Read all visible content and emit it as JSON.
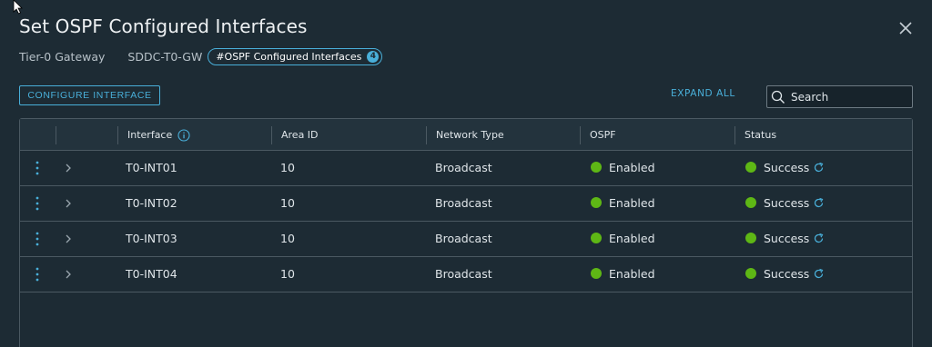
{
  "modal": {
    "title": "Set OSPF Configured Interfaces",
    "gateway_type": "Tier-0 Gateway",
    "gateway_name": "SDDC-T0-GW",
    "pill_label": "#OSPF Configured Interfaces",
    "pill_count": "4"
  },
  "toolbar": {
    "configure_label": "CONFIGURE INTERFACE",
    "expand_all_label": "EXPAND ALL",
    "search_placeholder": "Search"
  },
  "table": {
    "columns": [
      "Interface",
      "Area ID",
      "Network Type",
      "OSPF",
      "Status"
    ],
    "rows": [
      {
        "interface": "T0-INT01",
        "area_id": "10",
        "network_type": "Broadcast",
        "ospf": "Enabled",
        "status": "Success"
      },
      {
        "interface": "T0-INT02",
        "area_id": "10",
        "network_type": "Broadcast",
        "ospf": "Enabled",
        "status": "Success"
      },
      {
        "interface": "T0-INT03",
        "area_id": "10",
        "network_type": "Broadcast",
        "ospf": "Enabled",
        "status": "Success"
      },
      {
        "interface": "T0-INT04",
        "area_id": "10",
        "network_type": "Broadcast",
        "ospf": "Enabled",
        "status": "Success"
      }
    ]
  },
  "colors": {
    "accent": "#49afd9",
    "success": "#5eb715",
    "background": "#1d2b34"
  },
  "icons": {
    "close": "close-icon",
    "search": "search-icon",
    "info": "info-icon",
    "row_menu": "vertical-ellipsis-icon",
    "expand": "chevron-right-icon",
    "status_refresh": "refresh-icon"
  }
}
